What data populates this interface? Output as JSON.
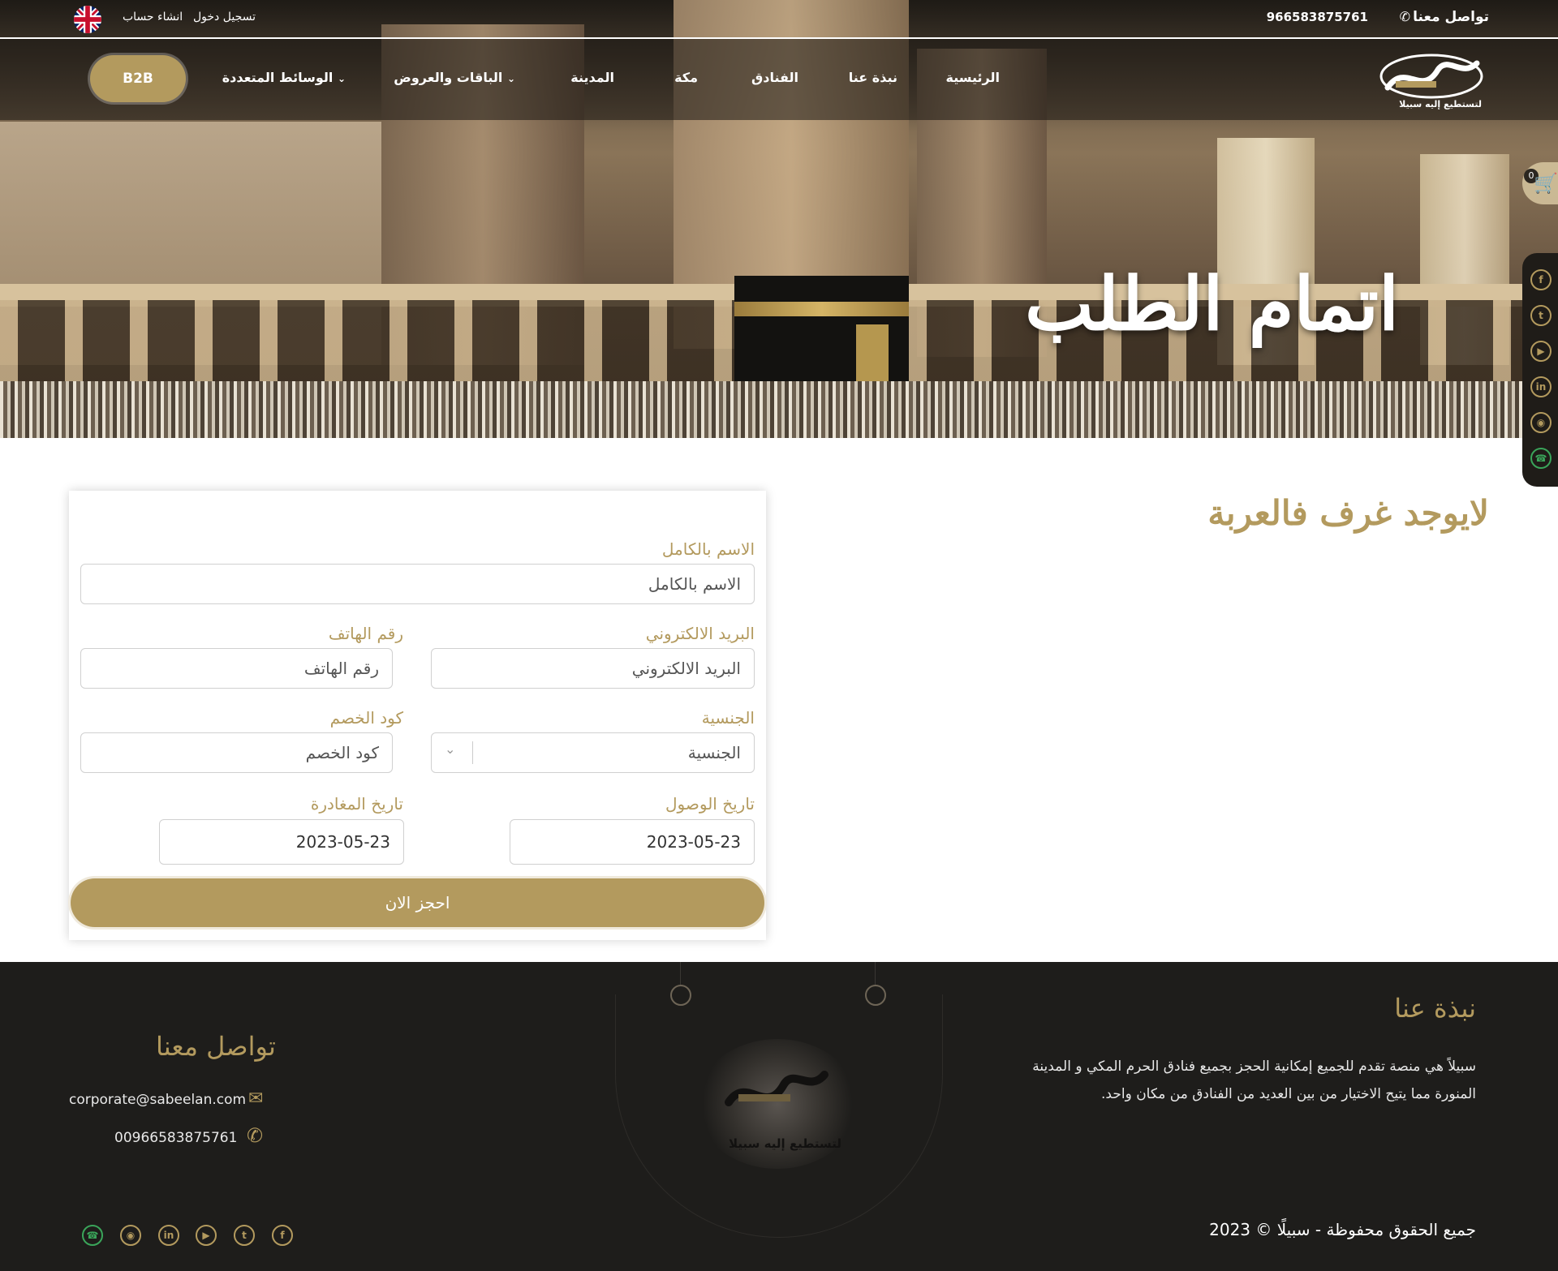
{
  "topbar": {
    "contact_label": "تواصل معنا",
    "phone": "966583875761",
    "login": "تسجيل دخول",
    "signup": "انشاء حساب",
    "language_flag": "uk-flag-icon"
  },
  "nav": {
    "logo_tagline": "لتستطيع إليه سبيلا",
    "items": [
      "الرئيسية",
      "نبذة عنا",
      "الفنادق",
      "مكة",
      "المدينة",
      "الباقات والعروض",
      "الوسائط المتعددة"
    ],
    "b2b": "B2B"
  },
  "hero": {
    "title": "اتمام الطلب"
  },
  "cart": {
    "count": "0"
  },
  "main": {
    "no_rooms": "لايوجد غرف فالعربة"
  },
  "form": {
    "full_name_label": "الاسم بالكامل",
    "full_name_placeholder": "الاسم بالكامل",
    "email_label": "البريد الالكتروني",
    "email_placeholder": "البريد الالكتروني",
    "phone_label": "رقم الهاتف",
    "phone_placeholder": "رقم الهاتف",
    "nationality_label": "الجنسية",
    "nationality_value": "الجنسية",
    "discount_label": "كود الخصم",
    "discount_placeholder": "كود الخصم",
    "arrival_label": "تاريخ الوصول",
    "arrival_value": "2023-05-23",
    "departure_label": "تاريخ المغادرة",
    "departure_value": "2023-05-23",
    "submit": "احجز الان"
  },
  "footer": {
    "about_title": "نبذة عنا",
    "about_text": "سبيلاً هي منصة تقدم للجميع إمكانية الحجز بجميع فنادق الحرم المكي و المدينة المنورة مما يتيح الاختيار من بين العديد من الفنادق من مكان واحد.",
    "copyright": "جميع الحقوق محفوظة - سبيلًا © 2023",
    "contact_title": "تواصل معنا",
    "email": "corporate@sabeelan.com",
    "phone": "00966583875761",
    "logo_tagline": "لتستطيع إليه سبيلا"
  },
  "social": [
    "facebook-icon",
    "twitter-icon",
    "youtube-icon",
    "linkedin-icon",
    "instagram-icon",
    "whatsapp-icon"
  ],
  "colors": {
    "accent": "#b39a5e",
    "footer_bg": "#1e1d1b",
    "whatsapp": "#3aa55a"
  }
}
